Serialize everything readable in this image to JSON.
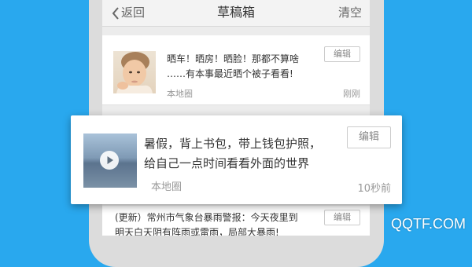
{
  "navbar": {
    "back_label": "返回",
    "title": "草稿箱",
    "clear_label": "清空"
  },
  "drafts": [
    {
      "line1": "晒车！晒房！晒脸！那都不算啥",
      "line2": "……有本事最近晒个被子看看!",
      "source": "本地圈",
      "time": "刚刚",
      "edit_label": "编辑"
    },
    {
      "line1": "暑假，背上书包，带上钱包护照，",
      "line2": "给自己一点时间看看外面的世界",
      "source": "本地圈",
      "time": "10秒前",
      "edit_label": "编辑"
    },
    {
      "line1": "(更新）常州市气象台暴雨警报：今天夜里到",
      "line2": "明天白天阴有阵雨或雷雨，局部大暴雨!",
      "edit_label": "编辑"
    }
  ],
  "watermark": "QQTF.COM",
  "colors": {
    "background": "#29a8ee",
    "phone_frame": "#dcdcdc",
    "screen": "#ececec",
    "text": "#333333",
    "muted": "#999999"
  }
}
